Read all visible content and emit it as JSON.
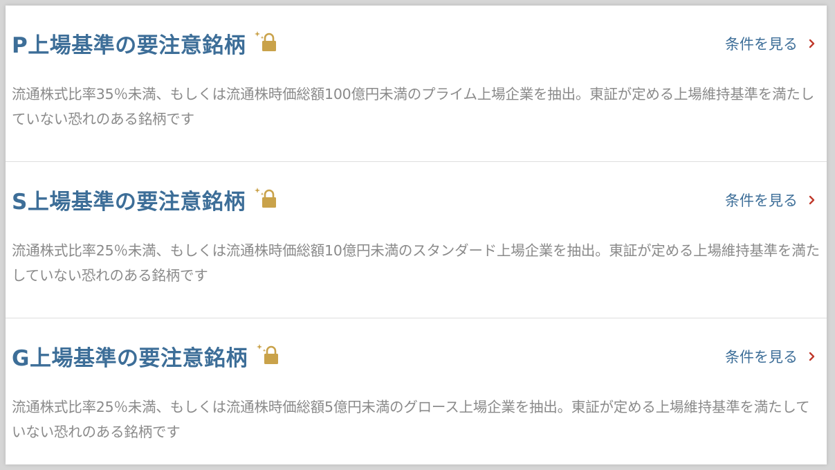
{
  "items": [
    {
      "title": "P上場基準の要注意銘柄",
      "link_label": "条件を見る",
      "description": "流通株式比率35％未満、もしくは流通株時価総額100億円未満のプライム上場企業を抽出。東証が定める上場維持基準を満たしていない恐れのある銘柄です"
    },
    {
      "title": "S上場基準の要注意銘柄",
      "link_label": "条件を見る",
      "description": "流通株式比率25％未満、もしくは流通株時価総額10億円未満のスタンダード上場企業を抽出。東証が定める上場維持基準を満たしていない恐れのある銘柄です"
    },
    {
      "title": "G上場基準の要注意銘柄",
      "link_label": "条件を見る",
      "description": "流通株式比率25％未満、もしくは流通株時価総額5億円未満のグロース上場企業を抽出。東証が定める上場維持基準を満たしていない恐れのある銘柄です"
    }
  ],
  "icons": {
    "premium": "premium-lock-icon",
    "link": "chevron-right-icon"
  },
  "colors": {
    "title": "#3d6e98",
    "link": "#3d6e98",
    "chevron": "#c0392b",
    "description": "#8a8a8a",
    "lock": "#c9a24a"
  }
}
